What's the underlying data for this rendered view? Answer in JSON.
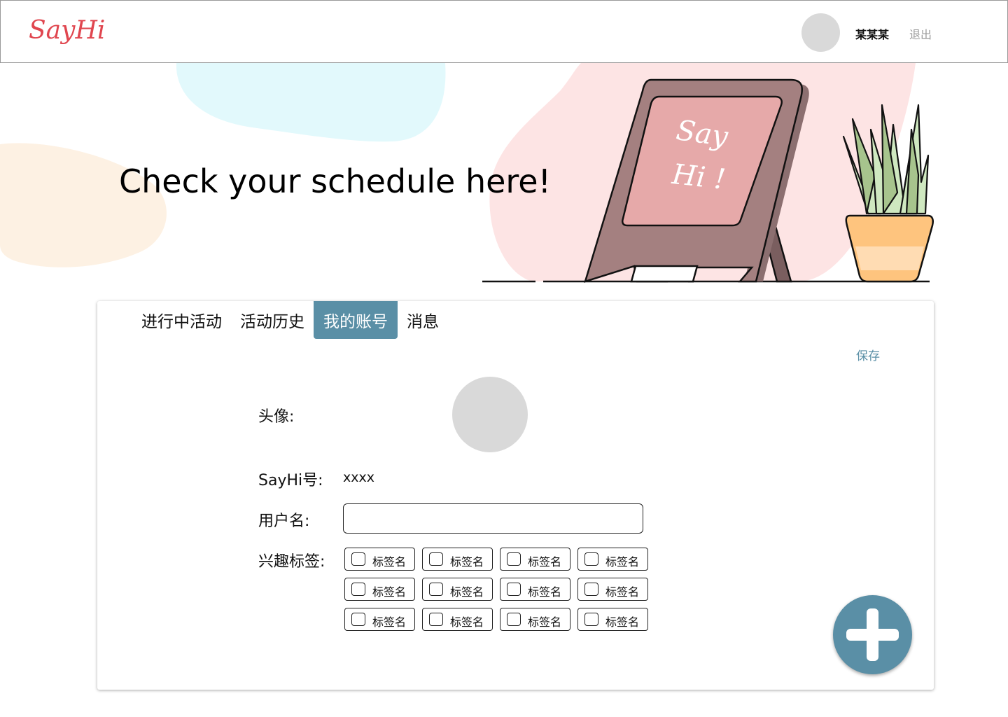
{
  "header": {
    "logo": "SayHi",
    "username": "某某某",
    "logout_label": "退出"
  },
  "hero": {
    "title": "Check your schedule here!",
    "sign_line1": "Say",
    "sign_line2": "Hi !"
  },
  "tabs": [
    {
      "label": "进行中活动",
      "active": false
    },
    {
      "label": "活动历史",
      "active": false
    },
    {
      "label": "我的账号",
      "active": true
    },
    {
      "label": "消息",
      "active": false
    }
  ],
  "account": {
    "save_label": "保存",
    "avatar_label": "头像:",
    "sayhi_id_label": "SayHi号:",
    "sayhi_id_value": "xxxx",
    "username_label": "用户名:",
    "username_value": "",
    "tags_label": "兴趣标签:",
    "tags": [
      "标签名",
      "标签名",
      "标签名",
      "标签名",
      "标签名",
      "标签名",
      "标签名",
      "标签名",
      "标签名",
      "标签名",
      "标签名",
      "标签名"
    ]
  },
  "colors": {
    "accent": "#5a8fa6",
    "logo": "#e0464f",
    "avatar": "#d9d9d9"
  },
  "icons": {
    "fab": "plus-icon",
    "checkbox": "checkbox-icon"
  }
}
